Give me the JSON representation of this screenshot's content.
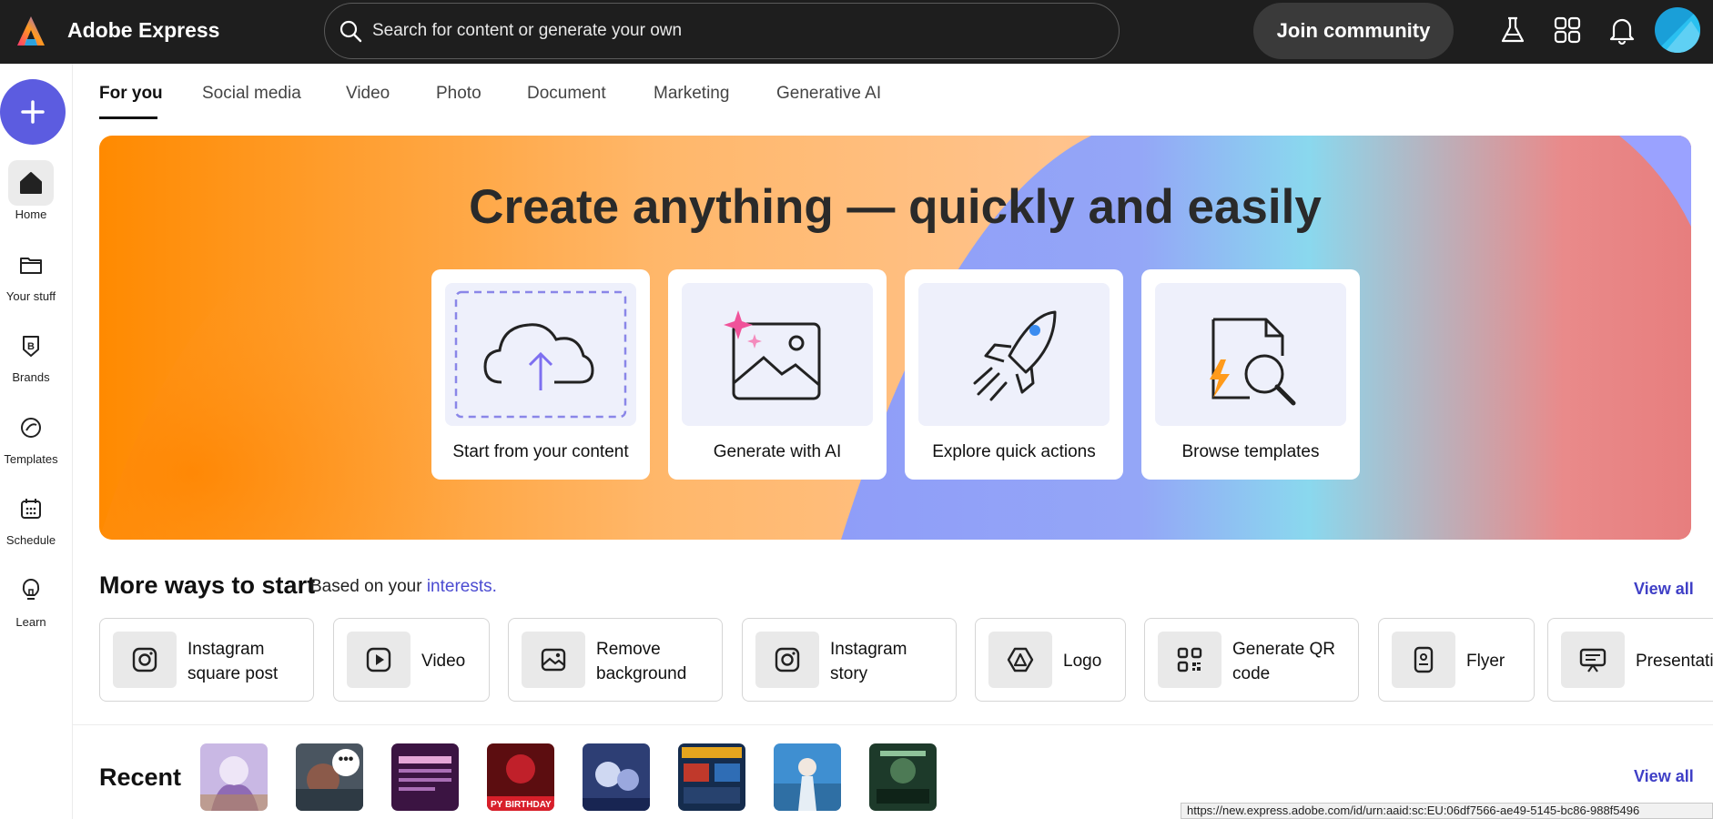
{
  "app": {
    "title": "Adobe Express"
  },
  "search": {
    "placeholder": "Search for content or generate your own"
  },
  "header": {
    "join_label": "Join community",
    "icons": [
      "labs-flask-icon",
      "apps-grid-icon",
      "notifications-bell-icon"
    ]
  },
  "rail": {
    "items": [
      {
        "label": "Home",
        "icon": "home-icon"
      },
      {
        "label": "Your stuff",
        "icon": "folder-icon"
      },
      {
        "label": "Brands",
        "icon": "brand-icon"
      },
      {
        "label": "Templates",
        "icon": "templates-icon"
      },
      {
        "label": "Schedule",
        "icon": "calendar-icon"
      },
      {
        "label": "Learn",
        "icon": "lightbulb-icon"
      }
    ]
  },
  "tabs": [
    "For you",
    "Social media",
    "Video",
    "Photo",
    "Document",
    "Marketing",
    "Generative AI"
  ],
  "hero": {
    "title": "Create anything — quickly and easily",
    "cards": [
      {
        "label": "Start from your content",
        "icon": "upload-cloud-icon"
      },
      {
        "label": "Generate with AI",
        "icon": "ai-image-icon"
      },
      {
        "label": "Explore quick actions",
        "icon": "rocket-icon"
      },
      {
        "label": "Browse templates",
        "icon": "template-search-icon"
      }
    ]
  },
  "more_ways": {
    "title": "More ways to start",
    "subtitle_prefix": "Based on your",
    "subtitle_link": "interests.",
    "view_all": "View all",
    "items": [
      {
        "line1": "Instagram",
        "line2": "square post",
        "icon": "instagram-icon"
      },
      {
        "line1": "Video",
        "line2": "",
        "icon": "video-play-icon"
      },
      {
        "line1": "Remove",
        "line2": "background",
        "icon": "remove-background-icon"
      },
      {
        "line1": "Instagram",
        "line2": "story",
        "icon": "instagram-icon"
      },
      {
        "line1": "Logo",
        "line2": "",
        "icon": "logo-icon"
      },
      {
        "line1": "Generate QR",
        "line2": "code",
        "icon": "qr-code-icon"
      },
      {
        "line1": "Flyer",
        "line2": "",
        "icon": "flyer-icon"
      },
      {
        "line1": "Presentati",
        "line2": "",
        "icon": "presentation-icon"
      }
    ]
  },
  "recent": {
    "title": "Recent",
    "view_all": "View all",
    "more_label": "•••",
    "thumb_caption": "PY BIRTHDAY LA"
  },
  "status_bar": {
    "url": "https://new.express.adobe.com/id/urn:aaid:sc:EU:06df7566-ae49-5145-bc86-988f5496"
  },
  "colors": {
    "accent": "#5c5ce0",
    "link": "#3f3fc6",
    "topbar": "#1e1e1e"
  }
}
